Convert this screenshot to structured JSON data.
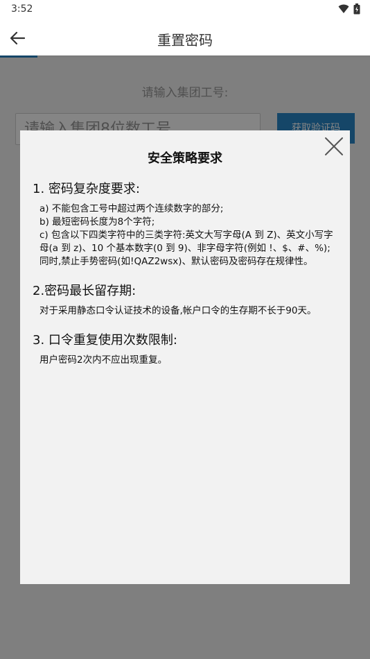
{
  "status_bar": {
    "time": "3:52",
    "icons": [
      "wifi-icon",
      "battery-icon"
    ]
  },
  "app_bar": {
    "title": "重置密码",
    "back_icon": "arrow-left-icon"
  },
  "form": {
    "employee_label": "请输入集团工号:",
    "employee_placeholder": "请输入集团8位数工号",
    "verify_button": "获取验证码"
  },
  "dialog": {
    "title": "安全策略要求",
    "close_icon": "close-icon",
    "sections": [
      {
        "heading": "1. 密码复杂度要求:",
        "lines": [
          "a) 不能包含工号中超过两个连续数字的部分;",
          "b) 最短密码长度为8个字符;",
          "c) 包含以下四类字符中的三类字符:英文大写字母(A 到 Z)、英文小写字母(a 到 z)、10 个基本数字(0 到 9)、非字母字符(例如 !、$、#、%);同时,禁止手势密码(如!QAZ2wsx)、默认密码及密码存在规律性。"
        ]
      },
      {
        "heading": "2.密码最长留存期:",
        "lines": [
          "对于采用静态口令认证技术的设备,帐户口令的生存期不长于90天。"
        ]
      },
      {
        "heading": "3. 口令重复使用次数限制:",
        "lines": [
          "用户密码2次内不应出现重复。"
        ]
      }
    ]
  },
  "colors": {
    "accent": "#2a86c8",
    "scrim": "#000000",
    "dialog_bg": "#f2f2f2"
  }
}
